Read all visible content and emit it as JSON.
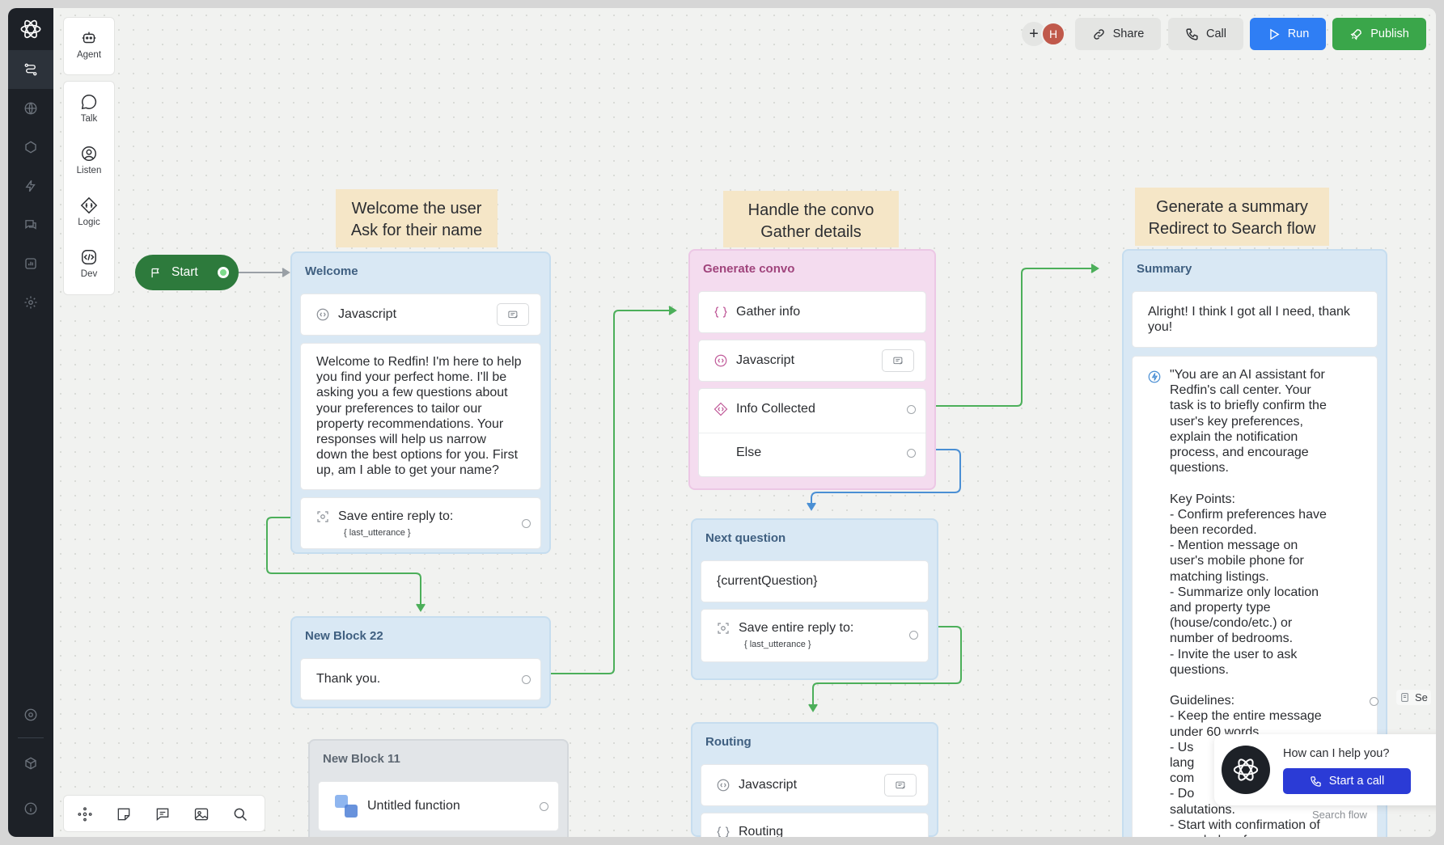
{
  "toolbar": {
    "tools": [
      {
        "label": "Agent",
        "icon": "robot-icon"
      },
      {
        "label": "Talk",
        "icon": "speech-bubble-icon"
      },
      {
        "label": "Listen",
        "icon": "listen-icon"
      },
      {
        "label": "Logic",
        "icon": "logic-icon"
      },
      {
        "label": "Dev",
        "icon": "code-icon"
      }
    ]
  },
  "header": {
    "avatar_initial": "H",
    "share_label": "Share",
    "call_label": "Call",
    "run_label": "Run",
    "publish_label": "Publish"
  },
  "notes": {
    "welcome": [
      "Welcome the user",
      "Ask for their name"
    ],
    "handle": [
      "Handle the convo",
      "Gather details"
    ],
    "summary": [
      "Generate a summary",
      "Redirect to Search flow"
    ]
  },
  "start": {
    "label": "Start"
  },
  "blocks": {
    "welcome": {
      "title": "Welcome",
      "js_label": "Javascript",
      "message": "Welcome to Redfin! I'm here to help\nyou find your perfect home. I'll be\nasking you a few questions about\nyour preferences to tailor our\nproperty recommendations. Your\nresponses will help us narrow\ndown the best options for you. First\nup, am I able to get your name?",
      "capture_label": "Save entire reply to:",
      "capture_var": "{ last_utterance }"
    },
    "new22": {
      "title": "New Block 22",
      "message": "Thank you."
    },
    "new11": {
      "title": "New Block 11",
      "function_label": "Untitled function"
    },
    "generate": {
      "title": "Generate convo",
      "gather_label": "Gather info",
      "js_label": "Javascript",
      "info_label": "Info Collected",
      "else_label": "Else"
    },
    "next": {
      "title": "Next question",
      "message": "{currentQuestion}",
      "capture_label": "Save entire reply to:",
      "capture_var": "{ last_utterance }"
    },
    "routing": {
      "title": "Routing",
      "js_label": "Javascript",
      "routing_label": "Routing"
    },
    "summary": {
      "title": "Summary",
      "message": "Alright! I think I got all I need, thank\nyou!",
      "prompt": "\"You are an AI assistant for\nRedfin's call center. Your\ntask is to briefly confirm the\nuser's key preferences,\nexplain the notification\nprocess, and encourage\nquestions.\n\nKey Points:\n- Confirm preferences have\nbeen recorded.\n- Mention message on\nuser's mobile phone for\nmatching listings.\n- Summarize only location\nand property type\n(house/condo/etc.) or\nnumber of bedrooms.\n- Invite the user to ask\nquestions.\n\nGuidelines:\n- Keep the entire message\nunder 60 words.\n- Us\nlang\ncom\n- Do\nsalutations.\n- Start with confirmation of\nrecorded preferences.",
      "offscreen_label": "Se"
    }
  },
  "chat_widget": {
    "question": "How can I help you?",
    "button_label": "Start a call",
    "ghost_text": "Search flow"
  }
}
